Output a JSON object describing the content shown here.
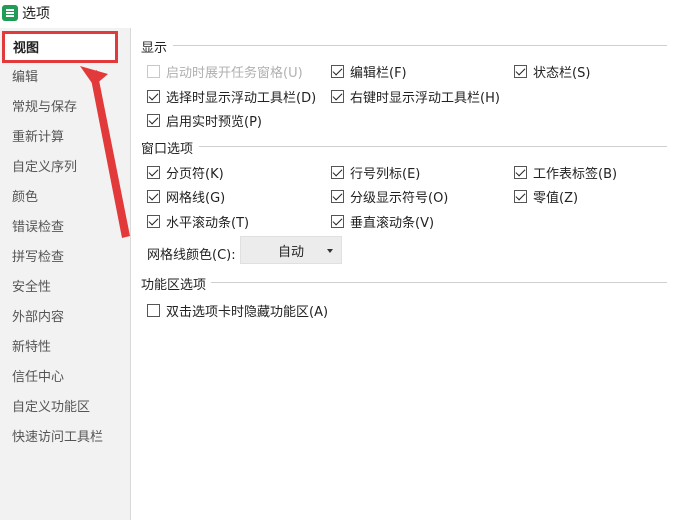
{
  "window": {
    "title": "选项"
  },
  "sidebar": {
    "items": [
      {
        "label": "视图"
      },
      {
        "label": "编辑"
      },
      {
        "label": "常规与保存"
      },
      {
        "label": "重新计算"
      },
      {
        "label": "自定义序列"
      },
      {
        "label": "颜色"
      },
      {
        "label": "错误检查"
      },
      {
        "label": "拼写检查"
      },
      {
        "label": "安全性"
      },
      {
        "label": "外部内容"
      },
      {
        "label": "新特性"
      },
      {
        "label": "信任中心"
      },
      {
        "label": "自定义功能区"
      },
      {
        "label": "快速访问工具栏"
      }
    ]
  },
  "display": {
    "title": "显示",
    "show_taskpane": "启动时展开任务窗格(U)",
    "formula_bar": "编辑栏(F)",
    "status_bar": "状态栏(S)",
    "floating_toolbar_select": "选择时显示浮动工具栏(D)",
    "floating_toolbar_rightclick": "右键时显示浮动工具栏(H)",
    "live_preview": "启用实时预览(P)"
  },
  "window_options": {
    "title": "窗口选项",
    "page_breaks": "分页符(K)",
    "row_col_headers": "行号列标(E)",
    "sheet_tabs": "工作表标签(B)",
    "gridlines": "网格线(G)",
    "outline_symbols": "分级显示符号(O)",
    "zero_values": "零值(Z)",
    "h_scrollbar": "水平滚动条(T)",
    "v_scrollbar": "垂直滚动条(V)",
    "gridline_color_label": "网格线颜色(C):",
    "gridline_color_value": "自动"
  },
  "ribbon": {
    "title": "功能区选项",
    "double_click_hide": "双击选项卡时隐藏功能区(A)"
  },
  "colors": {
    "annotation": "#e23a3a"
  }
}
